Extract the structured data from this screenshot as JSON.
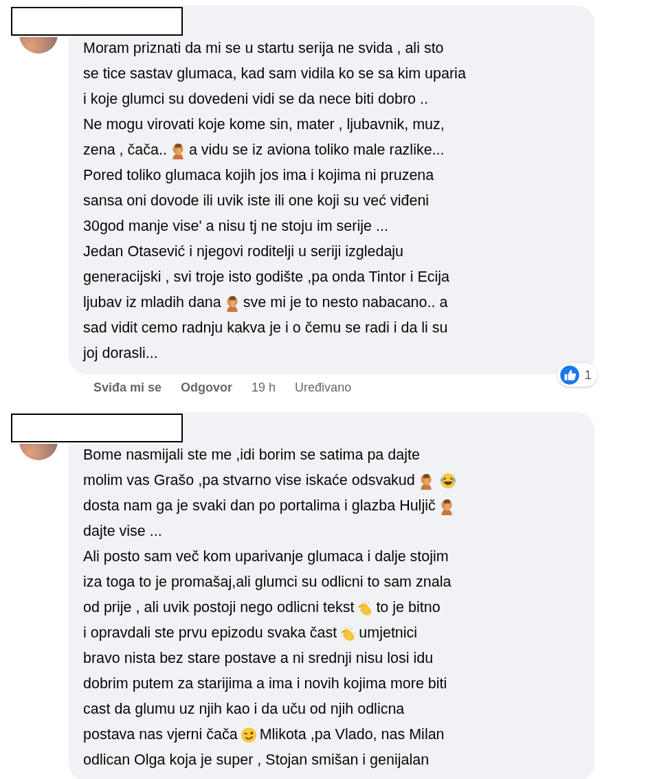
{
  "comments": [
    {
      "lines": [
        [
          {
            "kind": "text",
            "text": "Moram priznati da mi se u startu serija ne svida , ali sto"
          }
        ],
        [
          {
            "kind": "text",
            "text": "se tice sastav glumaca, kad sam vidila ko se sa kim uparia"
          }
        ],
        [
          {
            "kind": "text",
            "text": "i koje glumci su dovedeni vidi se da nece biti dobro .."
          }
        ],
        [
          {
            "kind": "text",
            "text": "Ne mogu virovati koje kome sin, mater , ljubavnik, muz,"
          }
        ],
        [
          {
            "kind": "text",
            "text": "zena , čača.."
          },
          {
            "kind": "facepalm"
          },
          {
            "kind": "text",
            "text": "a vidu se iz aviona toliko male razlike..."
          }
        ],
        [
          {
            "kind": "text",
            "text": "Pored toliko glumaca kojih jos ima i kojima ni pruzena"
          }
        ],
        [
          {
            "kind": "text",
            "text": "sansa oni dovode ili uvik iste ili one koji su već viđeni"
          }
        ],
        [
          {
            "kind": "text",
            "text": "30god manje vise' a nisu tj ne stoju im serije ..."
          }
        ],
        [
          {
            "kind": "text",
            "text": "Jedan Otasević i njegovi roditelji u seriji izgledaju"
          }
        ],
        [
          {
            "kind": "text",
            "text": "generacijski , svi troje isto godište ,pa onda Tintor i Ecija"
          }
        ],
        [
          {
            "kind": "text",
            "text": "ljubav iz mladih dana"
          },
          {
            "kind": "facepalm"
          },
          {
            "kind": "text",
            "text": "sve mi je to nesto nabacano.. a"
          }
        ],
        [
          {
            "kind": "text",
            "text": "sad vidit cemo radnju kakva je i o čemu se radi i da li su"
          }
        ],
        [
          {
            "kind": "text",
            "text": "joj dorasli..."
          }
        ]
      ],
      "reactions": {
        "count": "1"
      },
      "actions": [
        {
          "kind": "link",
          "text": "Sviđa mi se"
        },
        {
          "kind": "link",
          "text": "Odgovor"
        },
        {
          "kind": "meta",
          "text": "19 h"
        },
        {
          "kind": "meta",
          "text": "Uređivano"
        }
      ]
    },
    {
      "lines": [
        [
          {
            "kind": "text",
            "text": "Bome nasmijali ste me ,idi borim se satima pa dajte"
          }
        ],
        [
          {
            "kind": "text",
            "text": "molim vas Grašo ,pa stvarno vise iskaće odsvakud"
          },
          {
            "kind": "facepalm"
          },
          {
            "kind": "laugh"
          }
        ],
        [
          {
            "kind": "text",
            "text": "dosta nam ga je svaki dan po portalima i glazba Huljič"
          },
          {
            "kind": "facepalm"
          }
        ],
        [
          {
            "kind": "text",
            "text": "dajte vise ..."
          }
        ],
        [
          {
            "kind": "text",
            "text": "Ali posto sam več kom uparivanje glumaca i dalje stojim"
          }
        ],
        [
          {
            "kind": "text",
            "text": "iza toga to je promašaj,ali glumci su odlicni to sam znala"
          }
        ],
        [
          {
            "kind": "text",
            "text": "od prije , ali uvik postoji nego odlicni tekst"
          },
          {
            "kind": "clap"
          },
          {
            "kind": "text",
            "text": "to je bitno"
          }
        ],
        [
          {
            "kind": "text",
            "text": "i opravdali ste prvu epizodu svaka čast"
          },
          {
            "kind": "clap"
          },
          {
            "kind": "text",
            "text": "umjetnici"
          }
        ],
        [
          {
            "kind": "text",
            "text": "bravo nista bez stare postave a ni srednji nisu losi idu"
          }
        ],
        [
          {
            "kind": "text",
            "text": "dobrim putem za starijima a ima i novih kojima more biti"
          }
        ],
        [
          {
            "kind": "text",
            "text": "cast da glumu uz njih kao i da uču od njih odlicna"
          }
        ],
        [
          {
            "kind": "text",
            "text": "postava nas vjerni čača"
          },
          {
            "kind": "wink"
          },
          {
            "kind": "text",
            "text": "Mlikota ,pa Vlado, nas Milan"
          }
        ],
        [
          {
            "kind": "text",
            "text": "odlican Olga koja je super , Stojan smišan i genijalan"
          }
        ]
      ]
    }
  ]
}
